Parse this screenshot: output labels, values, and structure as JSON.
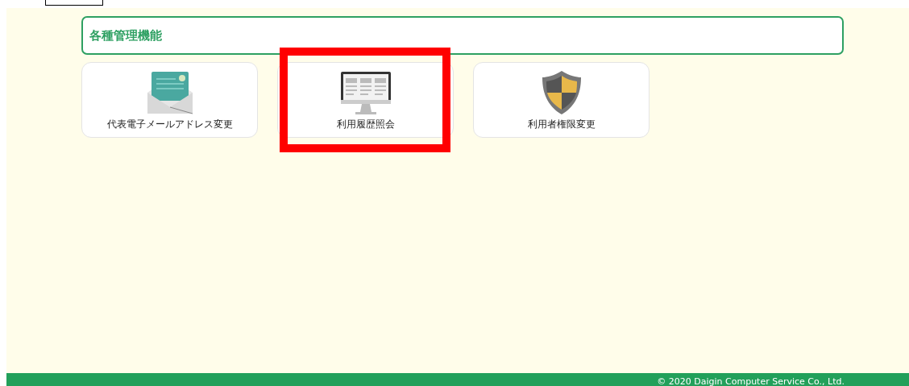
{
  "section": {
    "title": "各種管理機能"
  },
  "cards": [
    {
      "kind": "mail",
      "label": "代表電子メールアドレス変更",
      "highlighted": false
    },
    {
      "kind": "monitor",
      "label": "利用履歴照会",
      "highlighted": true
    },
    {
      "kind": "shield",
      "label": "利用者権限変更",
      "highlighted": false
    }
  ],
  "footer": {
    "copyright": "© 2020 Daigin Computer Service Co., Ltd."
  }
}
